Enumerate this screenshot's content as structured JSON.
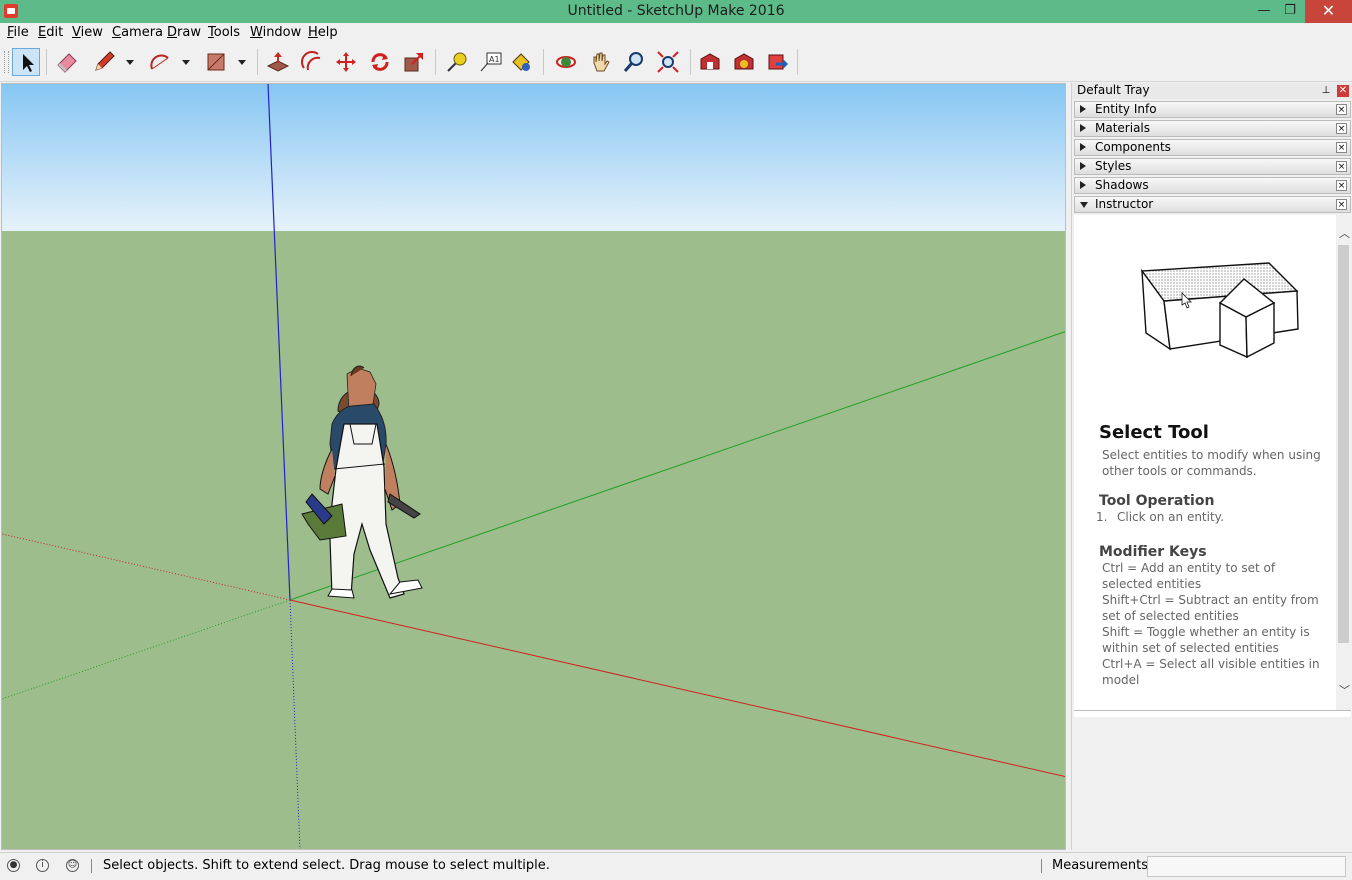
{
  "window": {
    "title": "Untitled - SketchUp Make 2016",
    "minimize": "—",
    "restore": "❐",
    "close": "✕"
  },
  "menu": [
    {
      "label": "File",
      "accel": "F"
    },
    {
      "label": "Edit",
      "accel": "E"
    },
    {
      "label": "View",
      "accel": "V"
    },
    {
      "label": "Camera",
      "accel": "C"
    },
    {
      "label": "Draw",
      "accel": "D"
    },
    {
      "label": "Tools",
      "accel": "T"
    },
    {
      "label": "Window",
      "accel": "W"
    },
    {
      "label": "Help",
      "accel": "H"
    }
  ],
  "toolbar": {
    "selected_tool": "select",
    "tools": [
      "select-tool",
      "eraser-tool",
      "line-tool",
      "arc-tool",
      "rectangle-tool",
      "push-pull-tool",
      "offset-tool",
      "move-tool",
      "rotate-tool",
      "scale-tool",
      "tape-measure-tool",
      "text-tool",
      "paint-bucket-tool",
      "orbit-tool",
      "pan-tool",
      "zoom-tool",
      "zoom-extents-tool",
      "3d-warehouse-tool",
      "extension-warehouse-tool",
      "share-model-tool"
    ]
  },
  "viewport": {
    "sky_color": "#8cc8f0",
    "ground_color": "#9dbd8d",
    "axis_red": "#d02020",
    "axis_green": "#20a020",
    "axis_blue": "#2020c0"
  },
  "tray": {
    "title": "Default Tray",
    "pin": "⊥",
    "close": "✕",
    "panels": [
      {
        "label": "Entity Info",
        "expanded": false
      },
      {
        "label": "Materials",
        "expanded": false
      },
      {
        "label": "Components",
        "expanded": false
      },
      {
        "label": "Styles",
        "expanded": false
      },
      {
        "label": "Shadows",
        "expanded": false
      },
      {
        "label": "Instructor",
        "expanded": true
      }
    ],
    "panel_close": "×"
  },
  "instructor": {
    "tool_title": "Select Tool",
    "description": "Select entities to modify when using other tools or commands.",
    "operation_heading": "Tool Operation",
    "step_number": "1.",
    "step_text": "Click on an entity.",
    "modifier_heading": "Modifier Keys",
    "modifiers": [
      "Ctrl = Add an entity to set of selected entities",
      "Shift+Ctrl = Subtract an entity from set of selected entities",
      "Shift = Toggle whether an entity is within set of selected entities",
      "Ctrl+A = Select all visible entities in model"
    ],
    "scroll_up": "︿",
    "scroll_down": "﹀"
  },
  "status": {
    "geo_icon": "●",
    "info_icon": "i",
    "user_icon": "☺",
    "message": "Select objects. Shift to extend select. Drag mouse to select multiple.",
    "measurements_label": "Measurements",
    "measurements_value": ""
  }
}
